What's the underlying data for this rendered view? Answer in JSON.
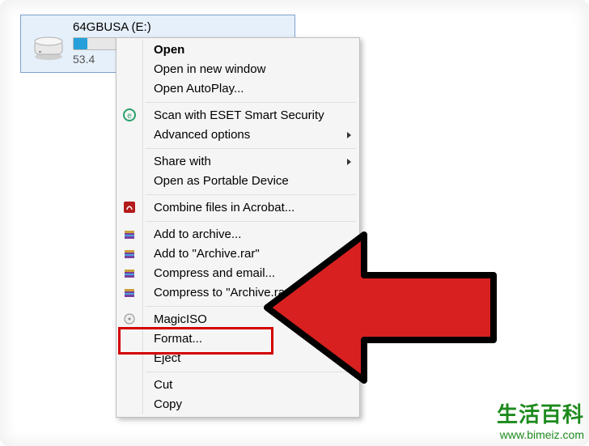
{
  "drive": {
    "title": "64GBUSA (E:)",
    "free_text": "53.4",
    "fill_percent": 7
  },
  "menu": [
    {
      "kind": "item",
      "label": "Open",
      "bold": true,
      "icon": null
    },
    {
      "kind": "item",
      "label": "Open in new window",
      "icon": null
    },
    {
      "kind": "item",
      "label": "Open AutoPlay...",
      "icon": null
    },
    {
      "kind": "sep"
    },
    {
      "kind": "item",
      "label": "Scan with ESET Smart Security",
      "icon": "eset"
    },
    {
      "kind": "item",
      "label": "Advanced options",
      "icon": null,
      "submenu": true
    },
    {
      "kind": "sep"
    },
    {
      "kind": "item",
      "label": "Share with",
      "icon": null,
      "submenu": true
    },
    {
      "kind": "item",
      "label": "Open as Portable Device",
      "icon": null
    },
    {
      "kind": "sep"
    },
    {
      "kind": "item",
      "label": "Combine files in Acrobat...",
      "icon": "acrobat"
    },
    {
      "kind": "sep"
    },
    {
      "kind": "item",
      "label": "Add to archive...",
      "icon": "winrar"
    },
    {
      "kind": "item",
      "label": "Add to \"Archive.rar\"",
      "icon": "winrar"
    },
    {
      "kind": "item",
      "label": "Compress and email...",
      "icon": "winrar"
    },
    {
      "kind": "item",
      "label": "Compress to \"Archive.rar\" and email",
      "icon": "winrar"
    },
    {
      "kind": "sep"
    },
    {
      "kind": "item",
      "label": "MagicISO",
      "icon": "magiciso",
      "submenu": true
    },
    {
      "kind": "item",
      "label": "Format...",
      "icon": null,
      "highlight": true
    },
    {
      "kind": "item",
      "label": "Eject",
      "icon": null
    },
    {
      "kind": "sep"
    },
    {
      "kind": "item",
      "label": "Cut",
      "icon": null
    },
    {
      "kind": "item",
      "label": "Copy",
      "icon": null
    }
  ],
  "watermark": {
    "line1": "生活百科",
    "line2": "www.bimeiz.com"
  }
}
